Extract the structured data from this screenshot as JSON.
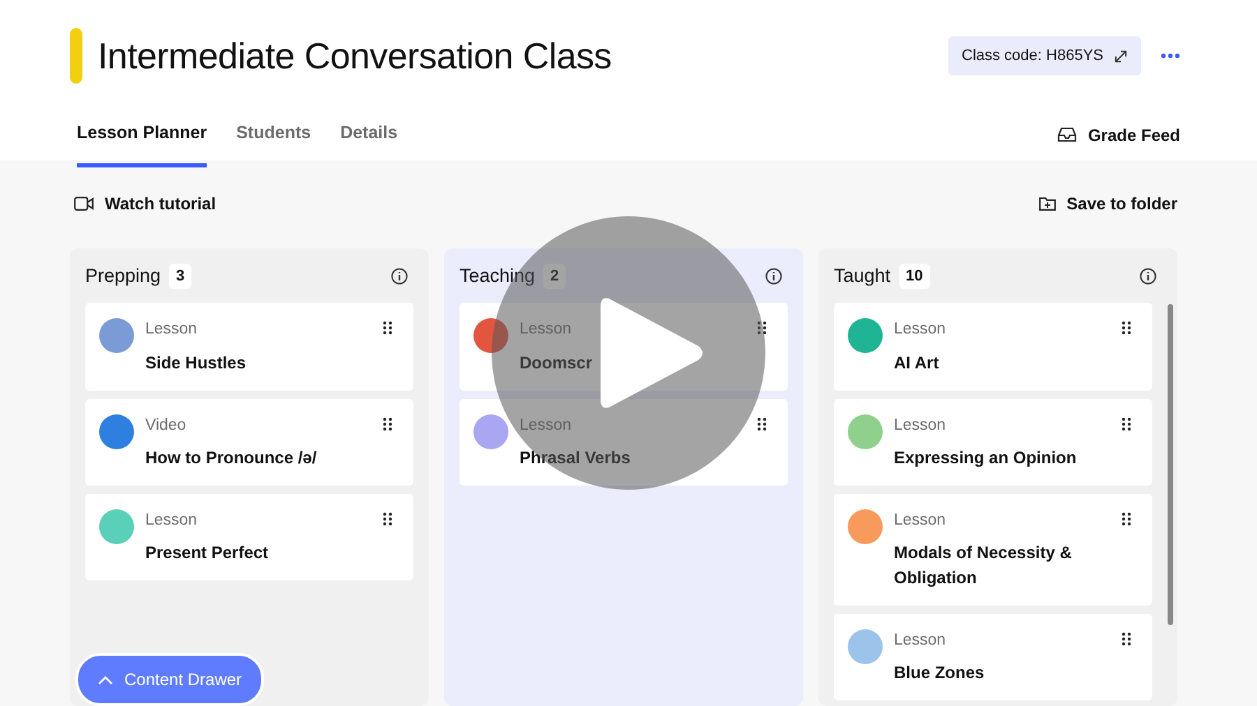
{
  "title": "Intermediate Conversation Class",
  "class_code": "Class code: H865YS",
  "tabs": [
    {
      "label": "Lesson Planner",
      "selected": true
    },
    {
      "label": "Students",
      "selected": false
    },
    {
      "label": "Details",
      "selected": false
    }
  ],
  "grade_feed": "Grade Feed",
  "watch_tutorial": "Watch tutorial",
  "save_to_folder": "Save to folder",
  "columns": [
    {
      "name": "Prepping",
      "count": "3",
      "highlighted": false,
      "cards": [
        {
          "type": "Lesson",
          "title": "Side Hustles",
          "color": "#7b9bd6"
        },
        {
          "type": "Video",
          "title": "How to Pronounce /ə/",
          "color": "#2f7fe0"
        },
        {
          "type": "Lesson",
          "title": "Present Perfect",
          "color": "#5ad0b8"
        }
      ]
    },
    {
      "name": "Teaching",
      "count": "2",
      "highlighted": true,
      "cards": [
        {
          "type": "Lesson",
          "title": "Doomscr",
          "color": "#e2553f"
        },
        {
          "type": "Lesson",
          "title": "Phrasal Verbs",
          "color": "#a9a6f2"
        }
      ]
    },
    {
      "name": "Taught",
      "count": "10",
      "highlighted": false,
      "cards": [
        {
          "type": "Lesson",
          "title": "AI Art",
          "color": "#1fb594"
        },
        {
          "type": "Lesson",
          "title": "Expressing an Opinion",
          "color": "#8fd18c"
        },
        {
          "type": "Lesson",
          "title": "Modals of Necessity & Obligation",
          "color": "#f79a5c"
        },
        {
          "type": "Lesson",
          "title": "Blue Zones",
          "color": "#9cc3ea"
        }
      ]
    }
  ],
  "content_drawer": "Content Drawer"
}
